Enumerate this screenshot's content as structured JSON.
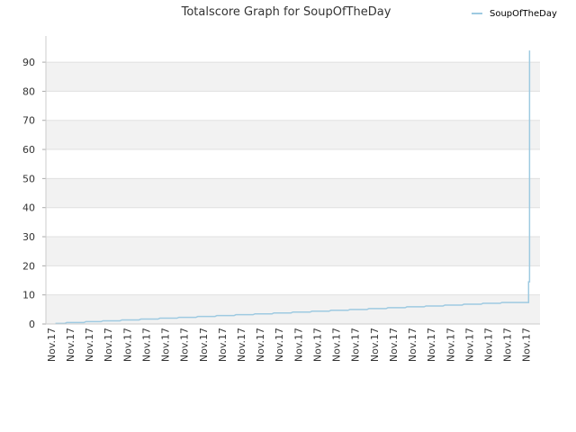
{
  "chart_data": {
    "type": "line",
    "title": "Totalscore Graph for SoupOfTheDay",
    "xlabel": "",
    "ylabel": "",
    "ylim": [
      0,
      99
    ],
    "yticks": [
      0,
      10,
      20,
      30,
      40,
      50,
      60,
      70,
      80,
      90
    ],
    "grid": true,
    "legend": "top-right",
    "categories": [
      "Nov.17",
      "Nov.17",
      "Nov.17",
      "Nov.17",
      "Nov.17",
      "Nov.17",
      "Nov.17",
      "Nov.17",
      "Nov.17",
      "Nov.17",
      "Nov.17",
      "Nov.17",
      "Nov.17",
      "Nov.17",
      "Nov.17",
      "Nov.17",
      "Nov.17",
      "Nov.17",
      "Nov.17",
      "Nov.17",
      "Nov.17",
      "Nov.17",
      "Nov.17",
      "Nov.17",
      "Nov.17",
      "Nov.17"
    ],
    "series": [
      {
        "name": "SoupOfTheDay",
        "color": "#9ecae1",
        "points": [
          [
            0,
            0.2
          ],
          [
            0.5,
            0.2
          ],
          [
            0.6,
            0.5
          ],
          [
            1.5,
            0.5
          ],
          [
            1.6,
            0.8
          ],
          [
            2.4,
            0.8
          ],
          [
            2.5,
            1.1
          ],
          [
            3.4,
            1.1
          ],
          [
            3.5,
            1.4
          ],
          [
            4.4,
            1.4
          ],
          [
            4.5,
            1.7
          ],
          [
            5.4,
            1.7
          ],
          [
            5.5,
            2.0
          ],
          [
            6.4,
            2.0
          ],
          [
            6.5,
            2.3
          ],
          [
            7.4,
            2.3
          ],
          [
            7.5,
            2.6
          ],
          [
            8.4,
            2.6
          ],
          [
            8.5,
            2.9
          ],
          [
            9.4,
            2.9
          ],
          [
            9.5,
            3.2
          ],
          [
            10.4,
            3.2
          ],
          [
            10.5,
            3.5
          ],
          [
            11.4,
            3.5
          ],
          [
            11.5,
            3.8
          ],
          [
            12.4,
            3.8
          ],
          [
            12.5,
            4.1
          ],
          [
            13.4,
            4.1
          ],
          [
            13.5,
            4.4
          ],
          [
            14.4,
            4.4
          ],
          [
            14.5,
            4.7
          ],
          [
            15.4,
            4.7
          ],
          [
            15.5,
            5.0
          ],
          [
            16.4,
            5.0
          ],
          [
            16.5,
            5.3
          ],
          [
            17.4,
            5.3
          ],
          [
            17.5,
            5.6
          ],
          [
            18.4,
            5.6
          ],
          [
            18.5,
            5.9
          ],
          [
            19.4,
            5.9
          ],
          [
            19.5,
            6.2
          ],
          [
            20.4,
            6.2
          ],
          [
            20.5,
            6.5
          ],
          [
            21.4,
            6.5
          ],
          [
            21.5,
            6.8
          ],
          [
            22.4,
            6.8
          ],
          [
            22.5,
            7.1
          ],
          [
            23.4,
            7.1
          ],
          [
            23.5,
            7.4
          ],
          [
            24.9,
            7.4
          ],
          [
            24.9,
            14.5
          ],
          [
            24.95,
            14.5
          ],
          [
            24.95,
            94.0
          ]
        ]
      }
    ]
  }
}
